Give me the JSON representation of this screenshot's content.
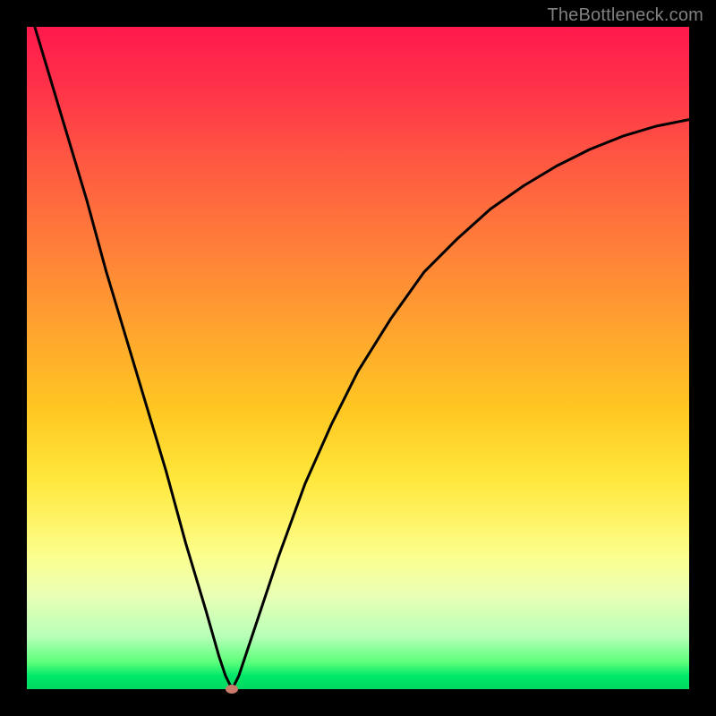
{
  "watermark": "TheBottleneck.com",
  "colors": {
    "frame": "#000000",
    "gradient_top": "#ff1a4d",
    "gradient_bottom": "#00d860",
    "curve": "#000000",
    "dot": "#c97a6a",
    "watermark": "#808080"
  },
  "chart_data": {
    "type": "line",
    "title": "",
    "xlabel": "",
    "ylabel": "",
    "xlim": [
      0,
      100
    ],
    "ylim": [
      0,
      100
    ],
    "grid": false,
    "legend": false,
    "annotations": [
      {
        "name": "minimum-dot",
        "x": 31,
        "y": 0
      }
    ],
    "series": [
      {
        "name": "bottleneck-curve",
        "x": [
          0,
          3,
          6,
          9,
          12,
          15,
          18,
          21,
          24,
          27,
          29,
          30,
          31,
          32,
          33,
          35,
          38,
          42,
          46,
          50,
          55,
          60,
          65,
          70,
          75,
          80,
          85,
          90,
          95,
          100
        ],
        "y": [
          104,
          94,
          84,
          74,
          63,
          53,
          43,
          33,
          22,
          12,
          5,
          2,
          0,
          2,
          5,
          11,
          20,
          31,
          40,
          48,
          56,
          63,
          68,
          72.5,
          76,
          79,
          81.5,
          83.5,
          85,
          86
        ]
      }
    ]
  }
}
